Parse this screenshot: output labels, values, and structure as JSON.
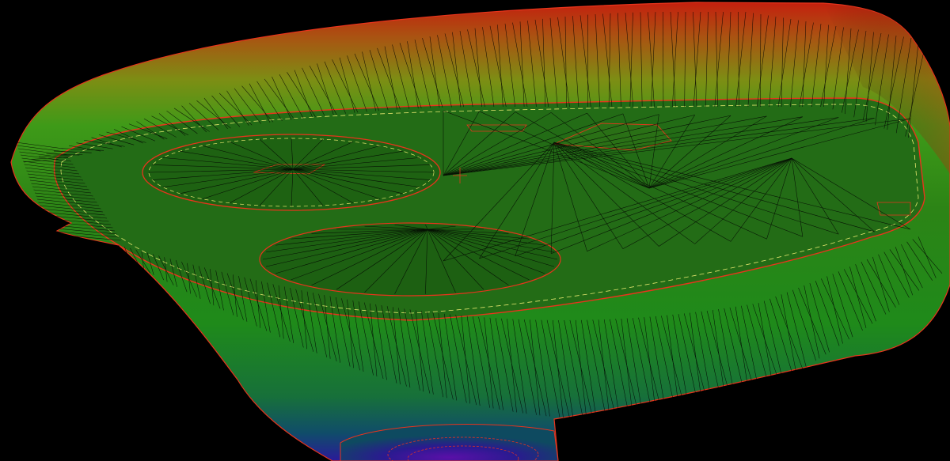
{
  "view": {
    "description_hidden": true,
    "background_color": "#000000"
  },
  "surface": {
    "shading": "elevation",
    "color_ramp": [
      "#c21a0c",
      "#b04a10",
      "#8a8a12",
      "#3f9a18",
      "#1e7a12",
      "#1f6c14",
      "#136a2a",
      "#0e5c46",
      "#142c8a",
      "#5a12a0"
    ],
    "triangle_edge_color": "#000000",
    "breakline_color": "#e8341c",
    "highlight_line_color": "#e8e870"
  }
}
